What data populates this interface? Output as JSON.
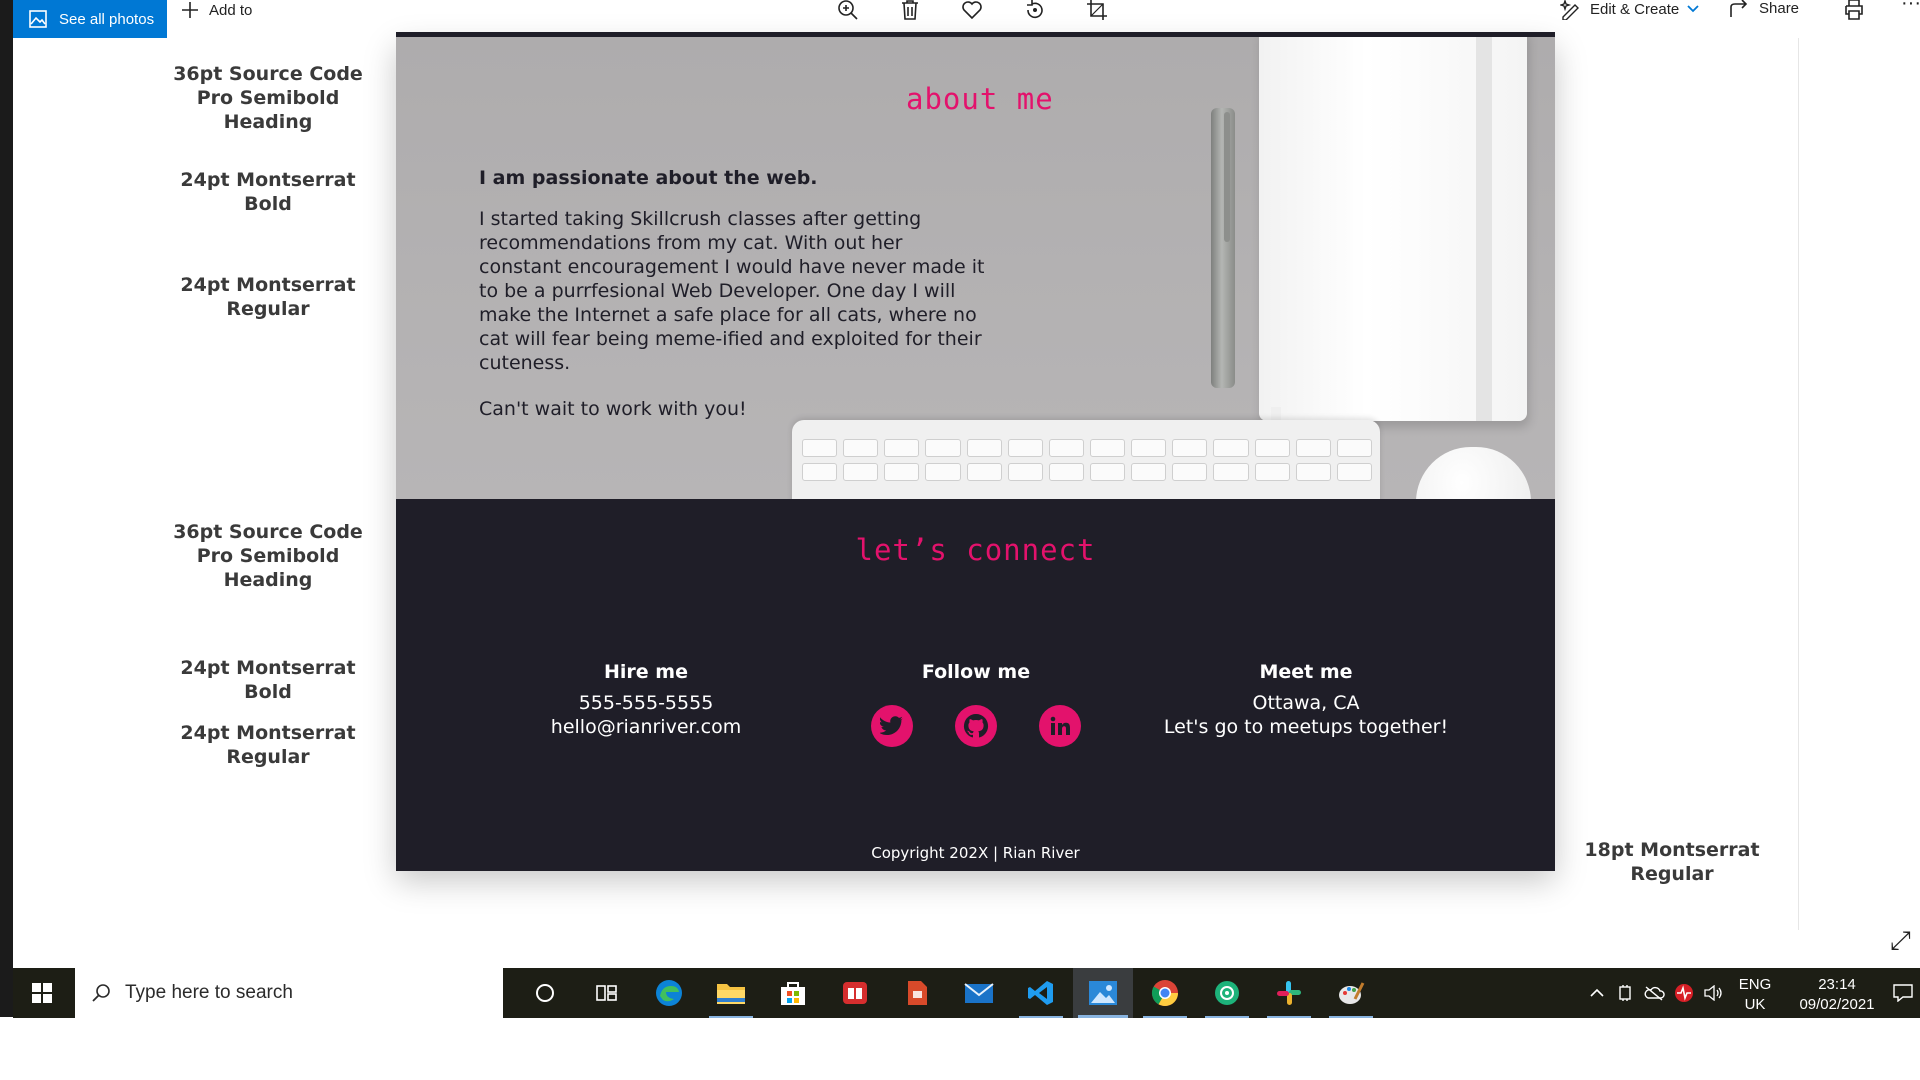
{
  "toolbar": {
    "see_all_photos": "See all photos",
    "add_to": "Add to",
    "icons": [
      "zoom-icon",
      "delete-icon",
      "favorite-icon",
      "rotate-icon",
      "crop-icon"
    ],
    "edit_create": "Edit & Create",
    "share": "Share",
    "more": "···"
  },
  "annotations": {
    "heading1": "36pt Source Code Pro Semibold Heading",
    "bold1": "24pt Montserrat Bold",
    "regular1": "24pt Montserrat Regular",
    "heading2": "36pt Source Code Pro Semibold Heading",
    "bold2": "24pt Montserrat Bold",
    "regular2": "24pt Montserrat Regular",
    "small": "18pt Montserrat Regular"
  },
  "about": {
    "title": "about me",
    "lead": "I am passionate about the web.",
    "body": "I started taking Skillcrush classes after getting recommendations from my cat. With out her constant encouragement I would have never made it to be a purrfesional Web Developer. One day I will make the Internet a safe place for all cats, where no cat will fear being meme-ified and exploited for their cuteness.",
    "closing": "Can't wait to work with you!"
  },
  "connect": {
    "title": "let’s connect",
    "hire": {
      "heading": "Hire me",
      "phone": "555-555-5555",
      "email": "hello@rianriver.com"
    },
    "follow": {
      "heading": "Follow me",
      "icons": [
        "twitter-icon",
        "github-icon",
        "linkedin-icon"
      ]
    },
    "meet": {
      "heading": "Meet me",
      "location": "Ottawa, CA",
      "note": "Let's go to meetups together!"
    },
    "copyright": "Copyright 202X  |  Rian River"
  },
  "colors": {
    "accent": "#e3126c",
    "dark": "#1f1e28",
    "toolbar_blue": "#0078d4",
    "taskbar": "#1d1e15"
  },
  "taskbar": {
    "search_placeholder": "Type here to search",
    "apps": [
      "cortana-icon",
      "task-view-icon",
      "edge-icon",
      "file-explorer-icon",
      "store-icon",
      "reader-icon",
      "app-icon",
      "mail-icon",
      "vscode-icon",
      "photos-icon",
      "chrome-icon",
      "app-icon-2",
      "slack-icon",
      "paint-icon"
    ],
    "lang_top": "ENG",
    "lang_bottom": "UK",
    "time": "23:14",
    "date": "09/02/2021"
  }
}
